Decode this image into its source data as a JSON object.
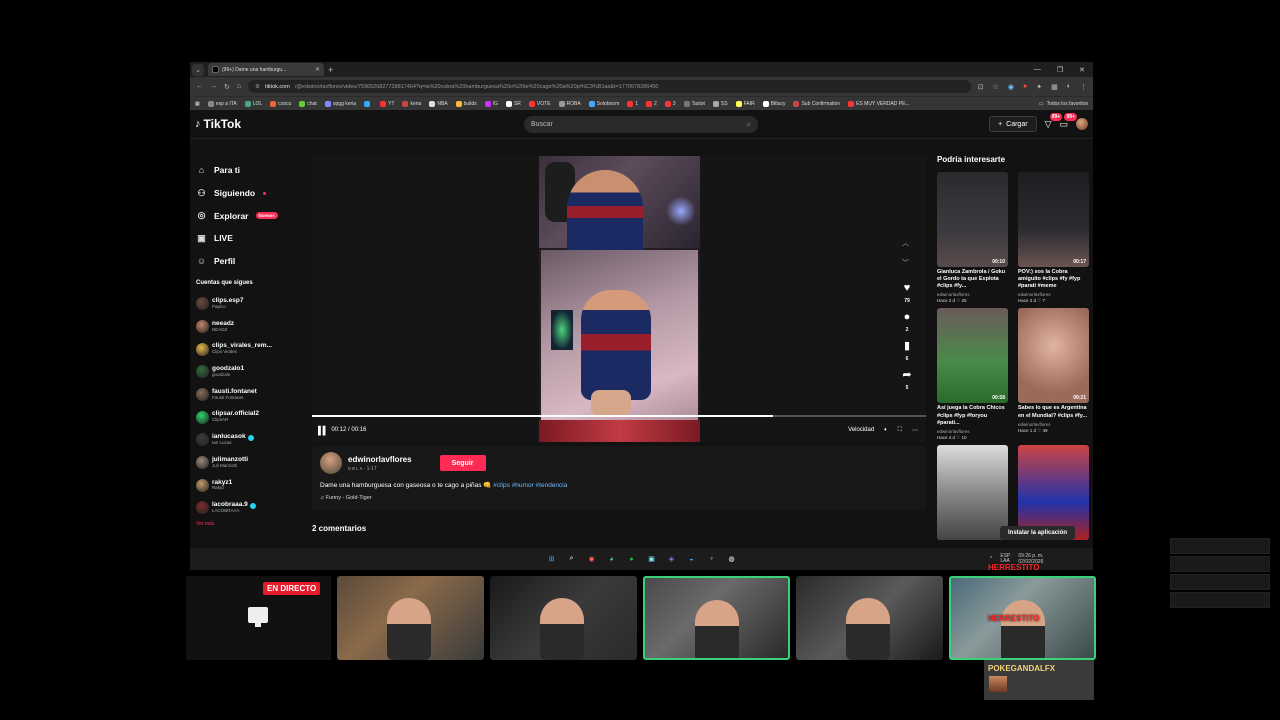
{
  "browser": {
    "tab_title": "(99+) Dame una hamburgu...",
    "url_domain": "tiktok.com",
    "url_path": "/@edwinorlavflores/video/7596526827728817464?q=la%20cobra%20hamburguesa%20o%20te%20cago%20a%20pi%C3%B1as&t=1770078286450",
    "bookmarks": [
      "esp a ITA",
      "LOL",
      "coscu",
      "chat",
      "opgg keria",
      "",
      "YT",
      "keria",
      "NBA",
      "builds",
      "IG",
      "SR",
      "VOTE",
      "ROBA",
      "Soloboom",
      "1",
      "2",
      "3",
      "Tastot",
      "SS",
      "FAIR",
      "Bitlucy",
      "Sub Confirmation",
      "ES MUY VERDAD PE..."
    ],
    "all_favorites": "Todos los favoritos"
  },
  "header": {
    "logo": "TikTok",
    "search_placeholder": "Buscar",
    "upload_label": "Cargar",
    "inbox_badge": "99+",
    "messages_badge": "99+"
  },
  "sidebar": {
    "nav": [
      {
        "label": "Para ti",
        "icon": "home-icon"
      },
      {
        "label": "Siguiendo",
        "icon": "following-icon"
      },
      {
        "label": "Explorar",
        "icon": "compass-icon",
        "badge": "Nuevos"
      },
      {
        "label": "LIVE",
        "icon": "live-icon"
      },
      {
        "label": "Perfil",
        "icon": "profile-icon"
      }
    ],
    "following_title": "Cuentas que sigues",
    "accounts": [
      {
        "user": "clips.esp7",
        "name": "Papico",
        "verified": false,
        "color": "#6b4a3a"
      },
      {
        "user": "neeadz",
        "name": "NEADZ",
        "verified": false,
        "color": "#c4846a"
      },
      {
        "user": "clips_virales_rem...",
        "name": "Clips Virales",
        "verified": false,
        "color": "#e8b64a"
      },
      {
        "user": "goodzalo1",
        "name": "goodzalo",
        "verified": false,
        "color": "#2f6b3a"
      },
      {
        "user": "fausti.fontanet",
        "name": "Fausti Fontanet",
        "verified": false,
        "color": "#8a6a5a"
      },
      {
        "user": "clipsar.official2",
        "name": "ClipsAR",
        "verified": false,
        "color": "#2fd46a"
      },
      {
        "user": "ianlucasok",
        "name": "Ian Lucas",
        "verified": true,
        "color": "#3a3a3a"
      },
      {
        "user": "julimanzotti",
        "name": "Juli Manzotti",
        "verified": false,
        "color": "#9a8a7a"
      },
      {
        "user": "rakyz1",
        "name": "Rakyz",
        "verified": false,
        "color": "#c49a6a"
      },
      {
        "user": "lacobraaa.9",
        "name": "LACOBRAAA",
        "verified": true,
        "color": "#7a2a2a"
      }
    ],
    "see_more": "Ver más"
  },
  "player": {
    "time": "00:12 / 00:16",
    "progress": 0.75,
    "speed_label": "Velocidad",
    "likes": "79",
    "comments": "2",
    "saves": "6",
    "shares": "5"
  },
  "video_info": {
    "author": "edwinorlavflores",
    "meta": "ᴏ ʀ ʟ ᴀ · 1-17",
    "follow_label": "Seguir",
    "description": "Dame una hamburguesa con gaseosa o te cago a piñas",
    "hashtags": [
      "#clips",
      "#humor",
      "#tendencia"
    ],
    "sound": "♫ Funny - Gold-Tiger"
  },
  "comments_title": "2 comentarios",
  "recommended": {
    "title": "Podría interesarte",
    "items": [
      {
        "title": "Gianluca Zambrola / Goku el Gordo ta que Explota #clips #fy...",
        "author": "edwinorlavflores",
        "meta": "Hace 2 d  ♡ 25",
        "duration": "00:10",
        "bg": "linear-gradient(#2a2a2e,#3a3a40 60%,#5a4a4a)"
      },
      {
        "title": "POV:) sos la Cobra amiguito #clips #fy #fyp #parati #meme",
        "author": "edwinorlavflores",
        "meta": "Hace 2 d  ♡ 7",
        "duration": "00:17",
        "bg": "linear-gradient(#1e1e22,#2a2a30 60%,#6a5450)"
      },
      {
        "title": "Así juega la Cobra Chicos #clips #fyp #foryou #parati...",
        "author": "edwinorlavflores",
        "meta": "Hace 4 d  ♡ 10",
        "duration": "00:58",
        "bg": "linear-gradient(#6a5a5a,#4a8a4a 55%,#2a6a2a)"
      },
      {
        "title": "Sabes lo que es Argentina en el Mundial? #clips #fy...",
        "author": "edwinorlavflores",
        "meta": "Hace 1 d  ♡ 49",
        "duration": "00:21",
        "bg": "radial-gradient(circle at 50% 40%,#e2b4a4,#9a6a5a 70%)"
      },
      {
        "title": "",
        "author": "",
        "meta": "",
        "duration": "",
        "bg": "linear-gradient(#ddd,#888 50%,#444)"
      },
      {
        "title": "",
        "author": "",
        "meta": "",
        "duration": "",
        "bg": "linear-gradient(#c44,#23a 60%,#a22)"
      }
    ]
  },
  "overlay": {
    "install_app": "Instalar la aplicación",
    "tray_lang": "ESP\nLAA",
    "clock_time": "09:26 p. m.",
    "clock_date": "02/02/2026",
    "live_badge": "EN DIRECTO",
    "cam_name_1": "HERRESTITO",
    "cam_name_2": "HERRESTITO",
    "poke_name": "POKEGANDALFX"
  },
  "webcams": [
    {
      "bg": "linear-gradient(135deg,#5a4a3a,#8a6a4a 40%,#3a3a3a)",
      "highlight": false
    },
    {
      "bg": "linear-gradient(135deg,#1a1a1a,#3a3a3a 50%,#2a2a2a)",
      "highlight": false
    },
    {
      "bg": "linear-gradient(135deg,#4a4a4a,#6a6a6a 40%,#2a2a2a)",
      "highlight": true
    },
    {
      "bg": "linear-gradient(135deg,#2a2a2a,#5a5a5a 50%,#1a1a1a)",
      "highlight": false
    },
    {
      "bg": "linear-gradient(135deg,#4a6a7a,#8a9a9a 40%,#3a4a4a)",
      "highlight": true
    }
  ]
}
